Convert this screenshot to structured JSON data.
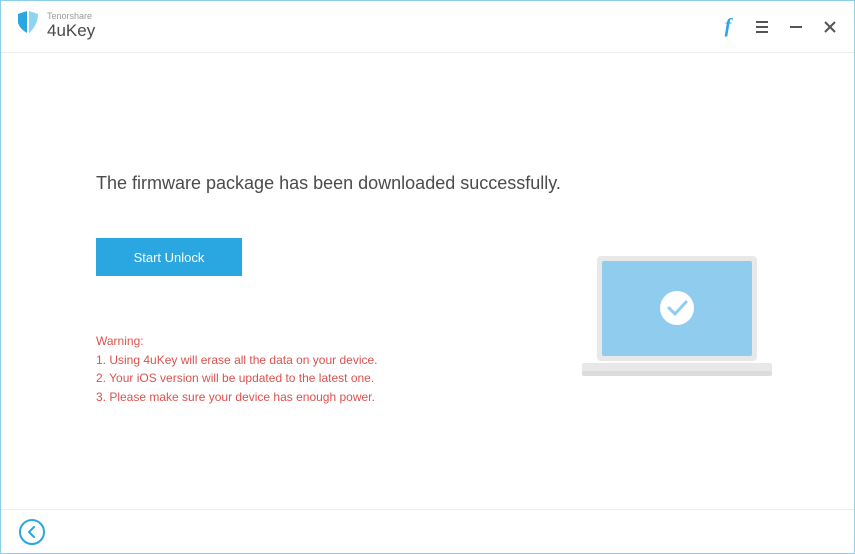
{
  "header": {
    "company": "Tenorshare",
    "product": "4uKey"
  },
  "main": {
    "headline": "The firmware package has been downloaded successfully.",
    "start_unlock_label": "Start Unlock",
    "warning_title": "Warning:",
    "warning_items": [
      "1. Using 4uKey will erase all the data on your device.",
      "2. Your iOS version will be updated to the latest one.",
      "3. Please make sure your device has enough power."
    ]
  },
  "icons": {
    "facebook": "f",
    "menu": "menu-icon",
    "minimize": "minimize-icon",
    "close": "close-icon",
    "back": "back-icon",
    "checkmark": "checkmark-icon",
    "shield": "shield-logo-icon"
  },
  "colors": {
    "accent": "#2aa7e0",
    "warning": "#d9534f",
    "laptop_screen": "#8fccee"
  }
}
